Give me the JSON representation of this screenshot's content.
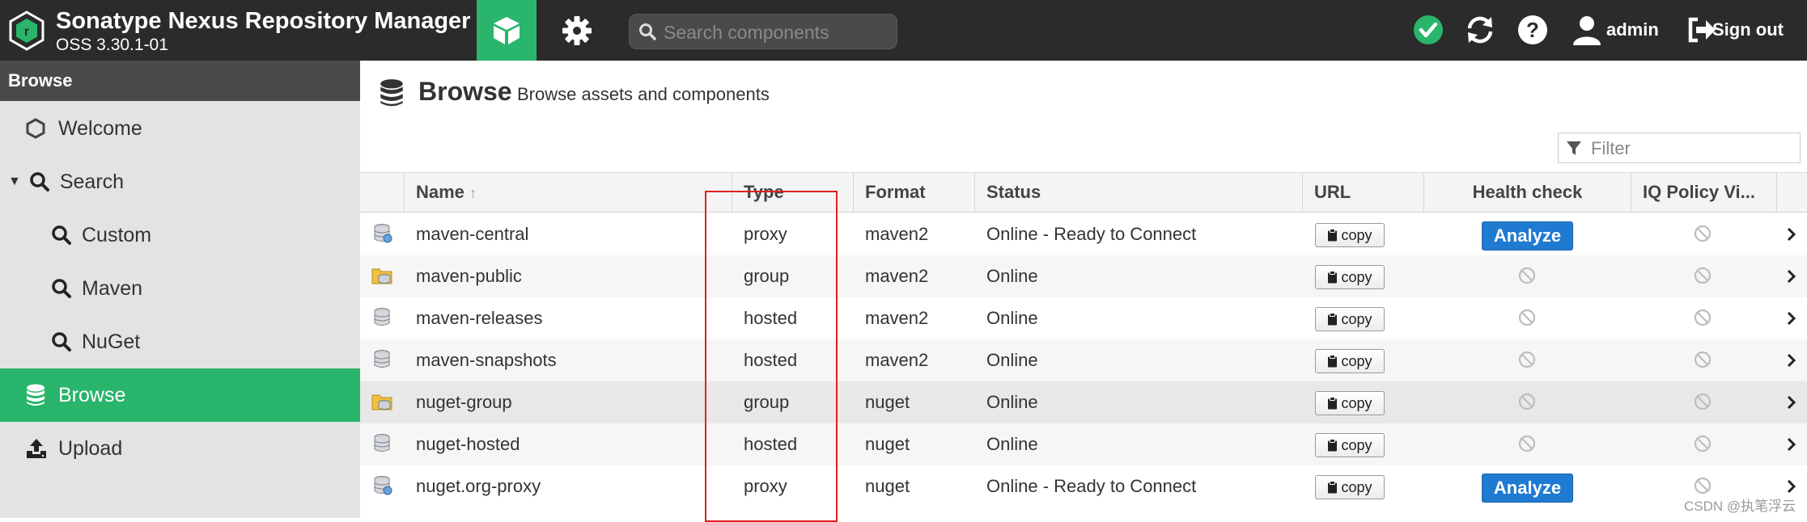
{
  "header": {
    "app_name": "Sonatype Nexus Repository Manager",
    "version": "OSS 3.30.1-01",
    "search_placeholder": "Search components",
    "user": "admin",
    "signout": "Sign out",
    "status_color": "#29b56b",
    "accent": "#29b56b"
  },
  "sidebar": {
    "header": "Browse",
    "items": [
      {
        "label": "Welcome",
        "icon": "hexagon-icon"
      },
      {
        "label": "Search",
        "icon": "search-icon",
        "expanded": true
      },
      {
        "label": "Custom",
        "icon": "search-icon"
      },
      {
        "label": "Maven",
        "icon": "search-icon"
      },
      {
        "label": "NuGet",
        "icon": "search-icon"
      },
      {
        "label": "Browse",
        "icon": "database-icon",
        "active": true
      },
      {
        "label": "Upload",
        "icon": "upload-icon"
      }
    ]
  },
  "main": {
    "title": "Browse",
    "subtitle": "Browse assets and components",
    "filter_placeholder": "Filter",
    "columns": {
      "name": "Name",
      "sort_indicator": "↑",
      "type": "Type",
      "format": "Format",
      "status": "Status",
      "url": "URL",
      "health": "Health check",
      "iq": "IQ Policy Vi..."
    },
    "copy_label": "copy",
    "analyze_label": "Analyze",
    "rows": [
      {
        "name": "maven-central",
        "type": "proxy",
        "format": "maven2",
        "status": "Online - Ready to Connect",
        "icon": "proxy-repo-icon"
      },
      {
        "name": "maven-public",
        "type": "group",
        "format": "maven2",
        "status": "Online",
        "icon": "group-repo-icon"
      },
      {
        "name": "maven-releases",
        "type": "hosted",
        "format": "maven2",
        "status": "Online",
        "icon": "hosted-repo-icon"
      },
      {
        "name": "maven-snapshots",
        "type": "hosted",
        "format": "maven2",
        "status": "Online",
        "icon": "hosted-repo-icon"
      },
      {
        "name": "nuget-group",
        "type": "group",
        "format": "nuget",
        "status": "Online",
        "icon": "group-repo-icon"
      },
      {
        "name": "nuget-hosted",
        "type": "hosted",
        "format": "nuget",
        "status": "Online",
        "icon": "hosted-repo-icon"
      },
      {
        "name": "nuget.org-proxy",
        "type": "proxy",
        "format": "nuget",
        "status": "Online - Ready to Connect",
        "icon": "proxy-repo-icon"
      }
    ]
  },
  "watermark": "CSDN @执笔浮云"
}
